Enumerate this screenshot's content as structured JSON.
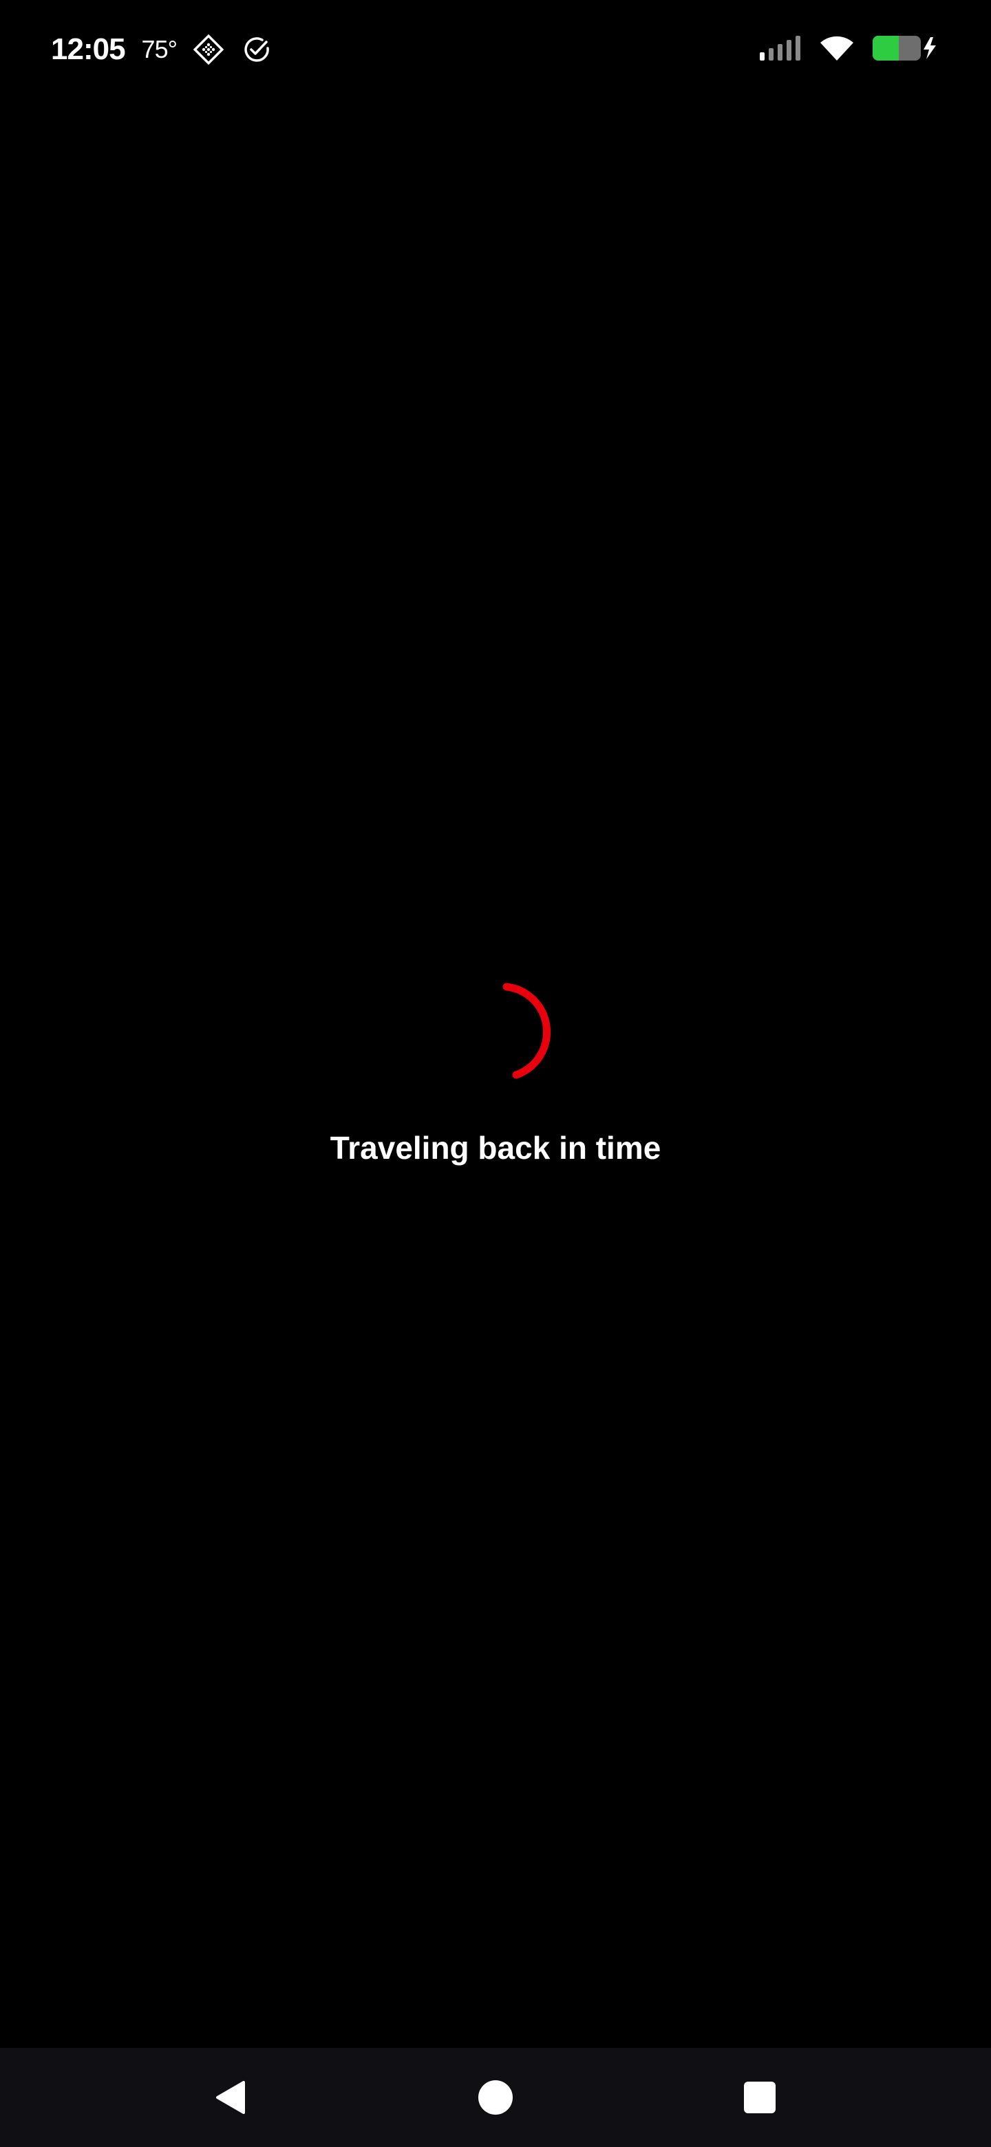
{
  "status_bar": {
    "time": "12:05",
    "temperature": "75°",
    "left_icons": [
      "sparkle-grid-icon",
      "check-circle-icon"
    ],
    "right_icons": [
      "signal-icon",
      "wifi-icon",
      "battery-charging-icon"
    ],
    "battery_level": 0.55,
    "battery_color": "#2ecc40"
  },
  "loader": {
    "message": "Traveling back in time",
    "spinner_color": "#e8000d"
  },
  "nav_bar": {
    "buttons": [
      "back-icon",
      "home-icon",
      "recents-icon"
    ]
  }
}
